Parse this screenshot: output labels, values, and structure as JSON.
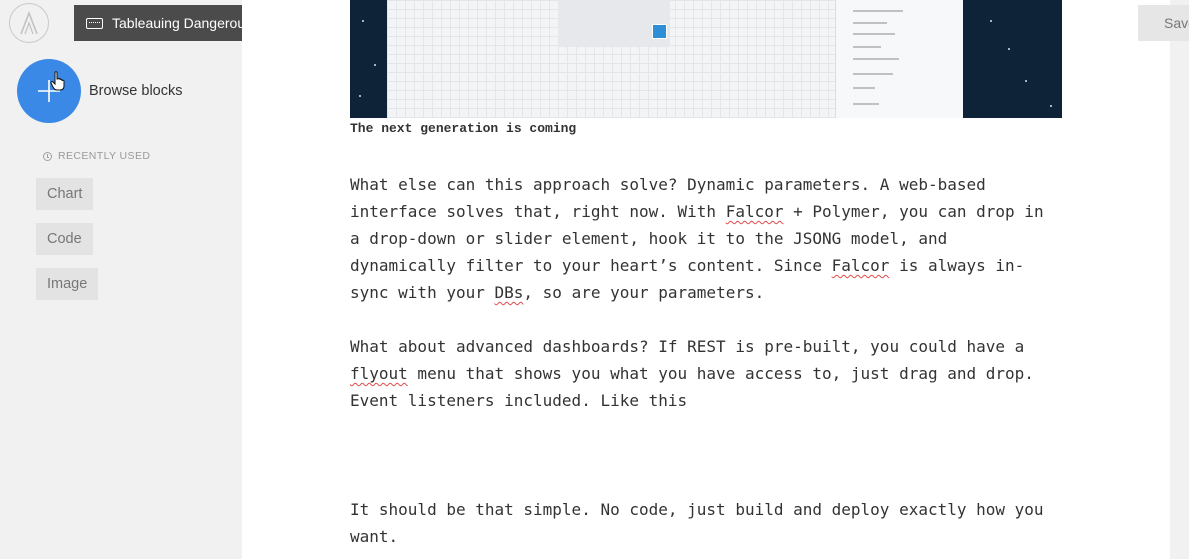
{
  "story": {
    "title": "Tableauing Dangerously"
  },
  "sidebar": {
    "browse_label": "Browse blocks",
    "recently_used_heading": "RECENTLY USED",
    "recent_items": [
      {
        "label": "Chart"
      },
      {
        "label": "Code"
      },
      {
        "label": "Image"
      }
    ]
  },
  "toolbar": {
    "save_label": "Save"
  },
  "content": {
    "image_caption": "The next generation is coming",
    "paragraph1": {
      "s1": "What else can this approach solve? Dynamic parameters. A web-based interface solves that, right now. With ",
      "w1": "Falcor",
      "s2": " + Polymer, you can drop in a drop-down or slider element, hook it to the JSONG model, and dynamically filter to your heart’s content. Since ",
      "w2": "Falcor",
      "s3": " is always in-sync with your ",
      "w3": "DBs",
      "s4": ", so are your parameters."
    },
    "paragraph2": {
      "s1": "What about advanced dashboards? If REST is pre-built, you could have a ",
      "w1": "flyout",
      "s2": " menu that shows you what you have access to, just drag and drop. Event listeners included. Like this"
    },
    "paragraph3": "It should be that simple. No code, just build and deploy exactly how you want."
  },
  "colors": {
    "accent": "#3b89e6",
    "sidebar_bg": "#f1f1f1",
    "badge_bg": "#4b4b4b",
    "spellcheck": "#e24a4a"
  },
  "icons": {
    "logo": "logo-icon",
    "story": "keyboard-icon",
    "add": "plus-icon",
    "recent": "clock-icon",
    "pointer": "hand-cursor-icon"
  }
}
